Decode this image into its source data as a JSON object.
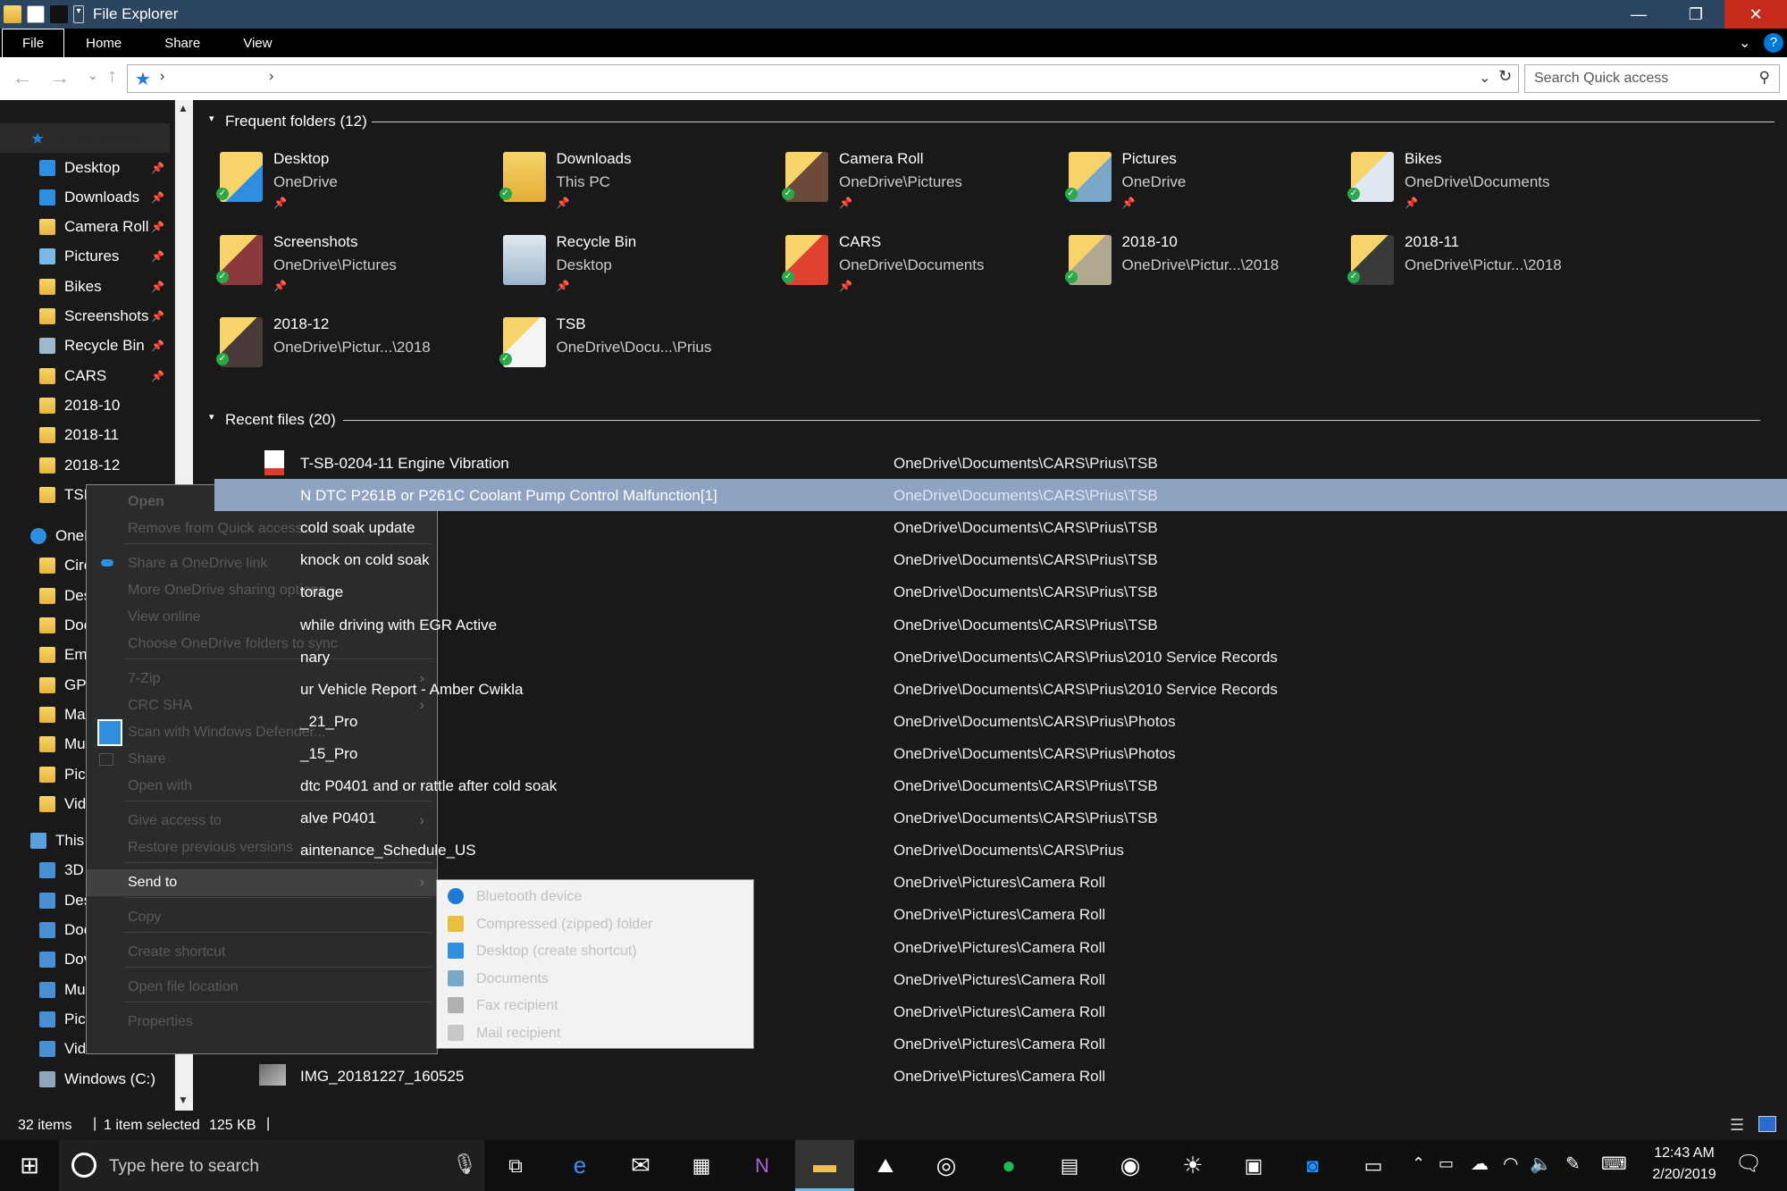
{
  "window": {
    "title": "File Explorer"
  },
  "ribbon": {
    "tabs": [
      "File",
      "Home",
      "Share",
      "View"
    ]
  },
  "address": {
    "search_placeholder": "Search Quick access"
  },
  "nav": {
    "quick_access": "Quick access",
    "items": [
      {
        "label": "Desktop",
        "pinned": true,
        "icon": "desktop-icon"
      },
      {
        "label": "Downloads",
        "pinned": true,
        "icon": "download-icon"
      },
      {
        "label": "Camera Roll",
        "pinned": true,
        "icon": "folder-icon"
      },
      {
        "label": "Pictures",
        "pinned": true,
        "icon": "pictures-icon"
      },
      {
        "label": "Bikes",
        "pinned": true,
        "icon": "folder-icon"
      },
      {
        "label": "Screenshots",
        "pinned": true,
        "icon": "folder-icon"
      },
      {
        "label": "Recycle Bin",
        "pinned": true,
        "icon": "recycle-bin-icon"
      },
      {
        "label": "CARS",
        "pinned": true,
        "icon": "folder-icon"
      },
      {
        "label": "2018-10",
        "pinned": false,
        "icon": "folder-icon"
      },
      {
        "label": "2018-11",
        "pinned": false,
        "icon": "folder-icon"
      },
      {
        "label": "2018-12",
        "pinned": false,
        "icon": "folder-icon"
      },
      {
        "label": "TSB",
        "pinned": false,
        "icon": "folder-icon"
      }
    ],
    "onedrive_label": "OneD",
    "onedrive_items": [
      "Circ",
      "Des",
      "Doc",
      "Em",
      "GPS",
      "Ma",
      "Mu",
      "Pict",
      "Vid"
    ],
    "this_pc_label": "This",
    "this_pc_items": [
      "3D",
      "Des",
      "Doc",
      "Dov",
      "Mu",
      "Pict",
      "Vid"
    ],
    "drive": "Windows (C:)"
  },
  "frequent": {
    "header": "Frequent folders (12)",
    "items": [
      {
        "name": "Desktop",
        "loc": "OneDrive",
        "pinned": true
      },
      {
        "name": "Downloads",
        "loc": "This PC",
        "pinned": true
      },
      {
        "name": "Camera Roll",
        "loc": "OneDrive\\Pictures",
        "pinned": true
      },
      {
        "name": "Pictures",
        "loc": "OneDrive",
        "pinned": true
      },
      {
        "name": "Bikes",
        "loc": "OneDrive\\Documents",
        "pinned": true
      },
      {
        "name": "Screenshots",
        "loc": "OneDrive\\Pictures",
        "pinned": true
      },
      {
        "name": "Recycle Bin",
        "loc": "Desktop",
        "pinned": true
      },
      {
        "name": "CARS",
        "loc": "OneDrive\\Documents",
        "pinned": true
      },
      {
        "name": "2018-10",
        "loc": "OneDrive\\Pictur...\\2018",
        "pinned": false
      },
      {
        "name": "2018-11",
        "loc": "OneDrive\\Pictur...\\2018",
        "pinned": false
      },
      {
        "name": "2018-12",
        "loc": "OneDrive\\Pictur...\\2018",
        "pinned": false
      },
      {
        "name": "TSB",
        "loc": "OneDrive\\Docu...\\Prius",
        "pinned": false
      }
    ]
  },
  "recent": {
    "header": "Recent files (20)",
    "rows": [
      {
        "name": "T-SB-0204-11 Engine Vibration",
        "path": "OneDrive\\Documents\\CARS\\Prius\\TSB"
      },
      {
        "name": "N DTC P261B or P261C  Coolant Pump Control Malfunction[1]",
        "path": "OneDrive\\Documents\\CARS\\Prius\\TSB",
        "selected": true
      },
      {
        "name": "cold soak update",
        "path": "OneDrive\\Documents\\CARS\\Prius\\TSB"
      },
      {
        "name": "knock on cold soak",
        "path": "OneDrive\\Documents\\CARS\\Prius\\TSB"
      },
      {
        "name": "torage",
        "path": "OneDrive\\Documents\\CARS\\Prius\\TSB"
      },
      {
        "name": "while driving with EGR Active",
        "path": "OneDrive\\Documents\\CARS\\Prius\\TSB"
      },
      {
        "name": "nary",
        "path": "OneDrive\\Documents\\CARS\\Prius\\2010 Service Records"
      },
      {
        "name": "ur Vehicle Report - Amber Cwikla",
        "path": "OneDrive\\Documents\\CARS\\Prius\\2010 Service Records"
      },
      {
        "name": "_21_Pro",
        "path": "OneDrive\\Documents\\CARS\\Prius\\Photos"
      },
      {
        "name": "_15_Pro",
        "path": "OneDrive\\Documents\\CARS\\Prius\\Photos"
      },
      {
        "name": "dtc P0401 and or rattle after cold soak",
        "path": "OneDrive\\Documents\\CARS\\Prius\\TSB"
      },
      {
        "name": "alve P0401",
        "path": "OneDrive\\Documents\\CARS\\Prius\\TSB"
      },
      {
        "name": "aintenance_Schedule_US",
        "path": "OneDrive\\Documents\\CARS\\Prius"
      },
      {
        "name": "",
        "path": "OneDrive\\Pictures\\Camera Roll"
      },
      {
        "name": "",
        "path": "OneDrive\\Pictures\\Camera Roll"
      },
      {
        "name": "",
        "path": "OneDrive\\Pictures\\Camera Roll"
      },
      {
        "name": "",
        "path": "OneDrive\\Pictures\\Camera Roll"
      },
      {
        "name": "",
        "path": "OneDrive\\Pictures\\Camera Roll"
      },
      {
        "name": "",
        "path": "OneDrive\\Pictures\\Camera Roll"
      },
      {
        "name": "IMG_20181227_160525",
        "path": "OneDrive\\Pictures\\Camera Roll"
      }
    ]
  },
  "context_menu": {
    "items": [
      {
        "label": "Open",
        "bold": true
      },
      {
        "label": "Remove from Quick access"
      },
      {
        "sep": true
      },
      {
        "label": "Share a OneDrive link"
      },
      {
        "label": "More OneDrive sharing options"
      },
      {
        "label": "View online"
      },
      {
        "label": "Choose OneDrive folders to sync"
      },
      {
        "sep": true
      },
      {
        "label": "7-Zip",
        "sub": true
      },
      {
        "label": "CRC SHA",
        "sub": true
      },
      {
        "label": "Scan with Windows Defender..."
      },
      {
        "label": "Share"
      },
      {
        "label": "Open with",
        "sub": true
      },
      {
        "sep": true
      },
      {
        "label": "Give access to",
        "sub": true
      },
      {
        "label": "Restore previous versions"
      },
      {
        "sep": true
      },
      {
        "label": "Send to",
        "sub": true,
        "highlighted": true
      },
      {
        "sep": true
      },
      {
        "label": "Copy"
      },
      {
        "sep": true
      },
      {
        "label": "Create shortcut"
      },
      {
        "sep": true
      },
      {
        "label": "Open file location"
      },
      {
        "sep": true
      },
      {
        "label": "Properties"
      }
    ]
  },
  "send_to": {
    "items": [
      {
        "label": "Bluetooth device",
        "icon": "bluetooth-icon"
      },
      {
        "label": "Compressed (zipped) folder",
        "icon": "zip-folder-icon"
      },
      {
        "label": "Desktop (create shortcut)",
        "icon": "desktop-icon"
      },
      {
        "label": "Documents",
        "icon": "documents-icon"
      },
      {
        "label": "Fax recipient",
        "icon": "fax-icon"
      },
      {
        "label": "Mail recipient",
        "icon": "mail-icon"
      }
    ]
  },
  "status": {
    "items": "32 items",
    "selected": "1 item selected",
    "size": "125 KB"
  },
  "taskbar": {
    "search_placeholder": "Type here to search",
    "time": "12:43 AM",
    "date": "2/20/2019"
  },
  "colors": {
    "titlebar": "#2b4560",
    "selection": "#8ea2c1",
    "folder": "#f0c14b",
    "accent": "#0078d7"
  }
}
